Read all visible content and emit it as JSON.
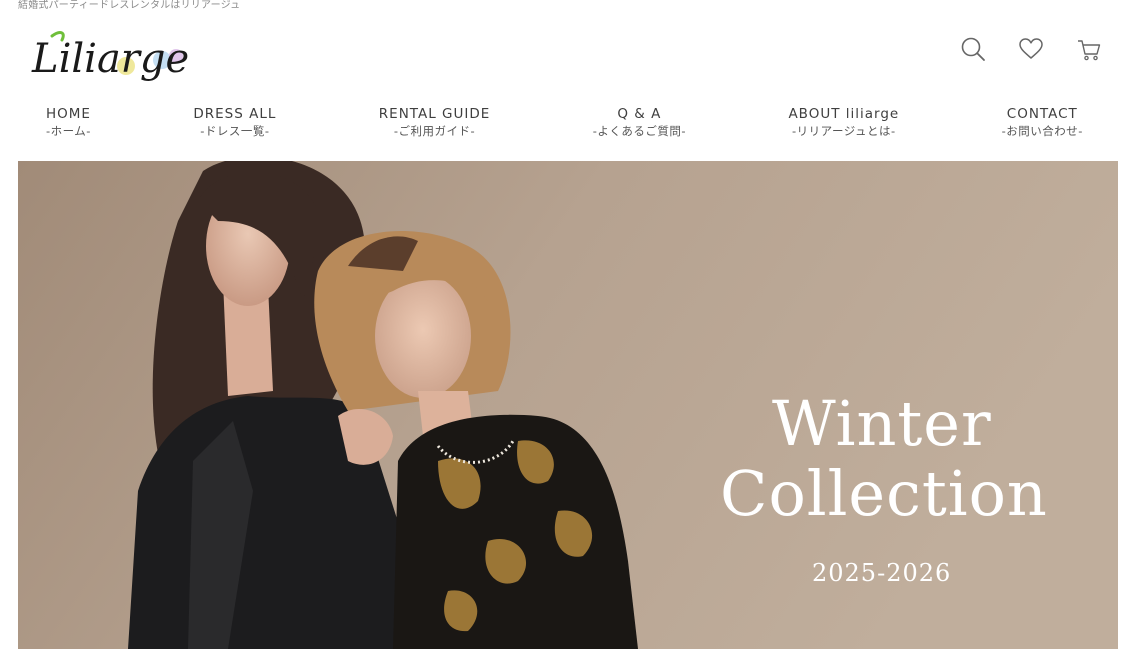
{
  "header": {
    "tagline": "結婚式パーティードレスレンタルはリリアージュ",
    "logo_text": "Liliarge",
    "icons": [
      {
        "name": "search-icon"
      },
      {
        "name": "heart-icon"
      },
      {
        "name": "cart-icon"
      }
    ]
  },
  "nav": {
    "items": [
      {
        "en": "HOME",
        "ja": "-ホーム-"
      },
      {
        "en": "DRESS ALL",
        "ja": "-ドレス一覧-"
      },
      {
        "en": "RENTAL GUIDE",
        "ja": "-ご利用ガイド-"
      },
      {
        "en": "Q & A",
        "ja": "-よくあるご質問-"
      },
      {
        "en": "ABOUT liliarge",
        "ja": "-リリアージュとは-"
      },
      {
        "en": "CONTACT",
        "ja": "-お問い合わせ-"
      }
    ]
  },
  "hero": {
    "title_line1": "Winter",
    "title_line2": "Collection",
    "year": "2025-2026"
  },
  "colors": {
    "nav_text": "#3f3f3f",
    "hero_bg": "#b39f8c",
    "hero_text": "#ffffff"
  }
}
